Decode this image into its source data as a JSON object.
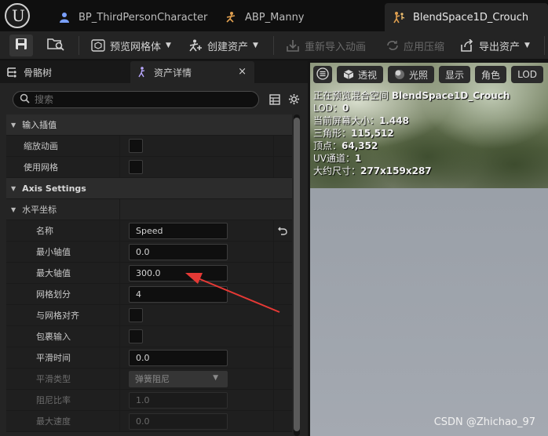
{
  "tabs": [
    {
      "label": "BP_ThirdPersonCharacter",
      "icon": "character-blueprint-icon"
    },
    {
      "label": "ABP_Manny",
      "icon": "anim-blueprint-icon"
    },
    {
      "label": "BlendSpace1D_Crouch",
      "icon": "blendspace-icon",
      "active": true
    }
  ],
  "toolbar": {
    "preview_mesh": "预览网格体",
    "create_asset": "创建资产",
    "reimport_anim": "重新导入动画",
    "apply_compression": "应用压缩",
    "export_asset": "导出资产"
  },
  "panel_tabs": {
    "skeleton_tree": "骨骼树",
    "asset_details": "资产详情"
  },
  "search": {
    "placeholder": "搜索"
  },
  "details": {
    "input_interp_category": "输入插值",
    "scale_animation": "缩放动画",
    "use_grid": "使用网格",
    "axis_settings_category": "Axis Settings",
    "horizontal_axis_category": "水平坐标",
    "name_label": "名称",
    "name_value": "Speed",
    "min_axis_label": "最小轴值",
    "min_axis_value": "0.0",
    "max_axis_label": "最大轴值",
    "max_axis_value": "300.0",
    "grid_divisions_label": "网格划分",
    "grid_divisions_value": "4",
    "snap_to_grid_label": "与网格对齐",
    "wrap_input_label": "包裹输入",
    "smoothing_time_label": "平滑时间",
    "smoothing_time_value": "0.0",
    "smoothing_type_label": "平滑类型",
    "smoothing_type_value": "弹簧阻尼",
    "damping_ratio_label": "阻尼比率",
    "damping_ratio_value": "1.0",
    "max_speed_label": "最大速度",
    "max_speed_value": "0.0"
  },
  "viewport": {
    "toolbar": {
      "perspective": "透视",
      "lighting": "光照",
      "show": "显示",
      "character": "角色",
      "lod": "LOD"
    },
    "info": {
      "preview_prefix": "正在预览混合空间 ",
      "preview_name": "BlendSpace1D_Crouch",
      "lod_label": "LOD：",
      "lod_value": "0",
      "screen_size_label": "当前屏幕大小：",
      "screen_size_value": "1.448",
      "triangles_label": "三角形：",
      "triangles_value": "115,512",
      "vertices_label": "顶点：",
      "vertices_value": "64,352",
      "uv_label": "UV通道：",
      "uv_value": "1",
      "approx_size_label": "大约尺寸：",
      "approx_size_value": "277x159x287"
    }
  },
  "watermark": "CSDN @Zhichao_97",
  "colors": {
    "annotation_arrow": "#e53935",
    "panel_bg": "#242424",
    "row_bg": "#1f1f1f"
  }
}
